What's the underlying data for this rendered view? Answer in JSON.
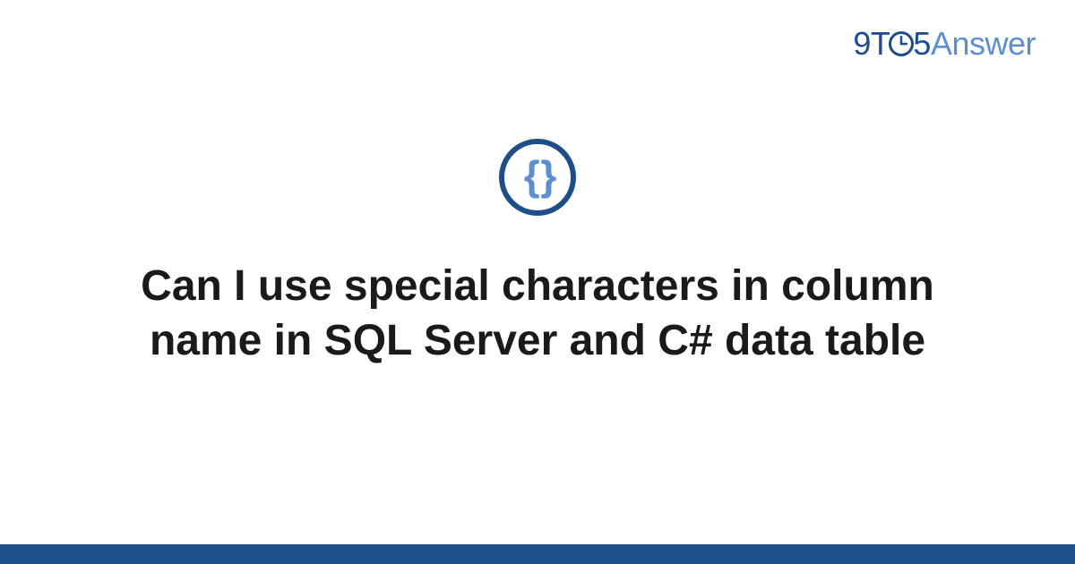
{
  "logo": {
    "part1": "9T",
    "part2": "5",
    "part3": "Answer"
  },
  "category": {
    "icon_name": "code-braces",
    "glyph": "{ }"
  },
  "question": {
    "title": "Can I use special characters in column name in SQL Server and C# data table"
  },
  "colors": {
    "brand_dark": "#1d4e89",
    "brand_light": "#5a8fd4",
    "text": "#1a1a1a"
  }
}
